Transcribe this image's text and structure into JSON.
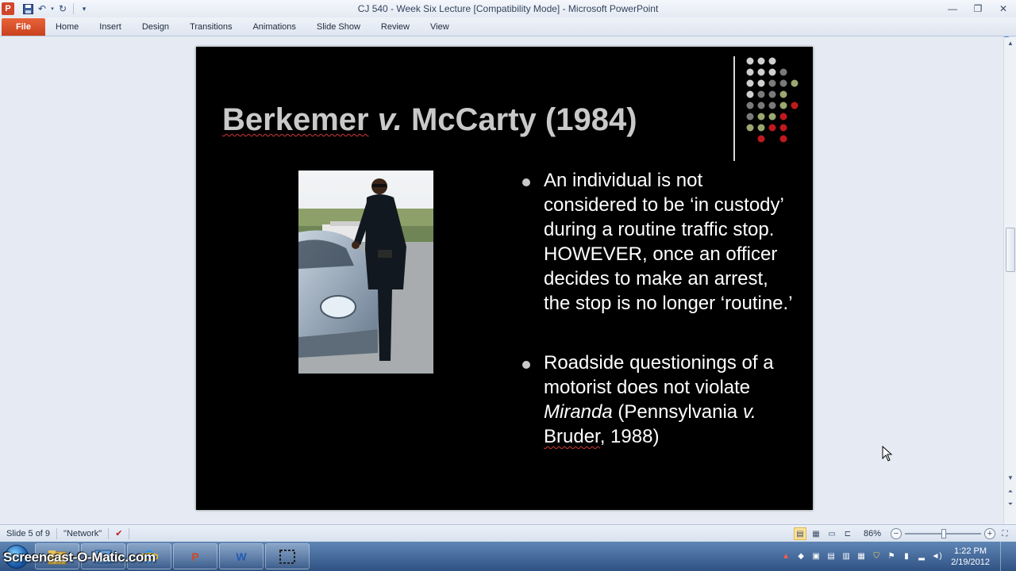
{
  "window": {
    "title": "CJ 540 - Week Six Lecture [Compatibility Mode] - Microsoft PowerPoint",
    "app_icon": "P",
    "controls": [
      "minimize-icon",
      "restore-icon",
      "close-icon"
    ]
  },
  "ribbon": {
    "tabs": [
      {
        "label": "File"
      },
      {
        "label": "Home"
      },
      {
        "label": "Insert"
      },
      {
        "label": "Design"
      },
      {
        "label": "Transitions"
      },
      {
        "label": "Animations"
      },
      {
        "label": "Slide Show"
      },
      {
        "label": "Review"
      },
      {
        "label": "View"
      }
    ]
  },
  "slide": {
    "title_part1": "Berkemer",
    "title_part2": "v.",
    "title_part3": " McCarty (1984)",
    "bullets": [
      "An individual is not considered to be ‘in custody’ during a routine traffic stop. HOWEVER, once an officer decides to make an arrest, the stop is no longer ‘routine.’"
    ],
    "bullet2": {
      "line1": "Roadside questionings of a motorist does not violate ",
      "italic": "Miranda",
      "line2": " (Pennsylvania ",
      "v": "v.",
      "space": " ",
      "bruder": "Bruder",
      "line3": ", 1988)"
    },
    "accent_colors": {
      "light": "#cfcfcf",
      "mid": "#7a7a7a",
      "olive": "#9aa870",
      "red": "#c0191d"
    }
  },
  "statusbar": {
    "slide_info": "Slide 5 of 9",
    "theme": "\"Network\"",
    "zoom": "86%"
  },
  "taskbar": {
    "watermark": "Screencast-O-Matic.com",
    "apps": [
      "P",
      "W"
    ],
    "time": "1:22 PM",
    "date": "2/19/2012"
  }
}
